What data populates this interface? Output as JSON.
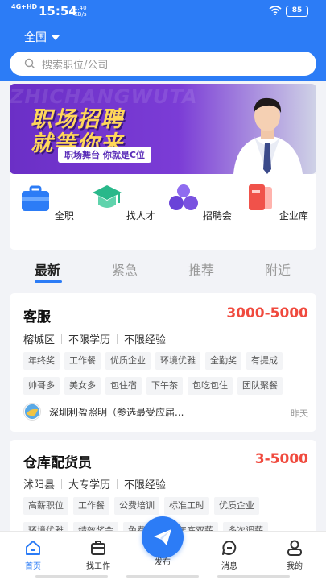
{
  "status": {
    "network": "4G+HD",
    "time": "15:54",
    "speed_value": "1.40",
    "speed_unit": "KB/s",
    "battery": "85"
  },
  "region": "全国",
  "search": {
    "placeholder": "搜索职位/公司"
  },
  "banner": {
    "watermark": "ZHICHANGWUTA",
    "line1": "职场招聘",
    "line2": "就等你来",
    "subtitle": "职场舞台 你就是C位"
  },
  "quick_links": [
    {
      "label": "全职",
      "icon": "briefcase-icon",
      "color": "#2c7cf6"
    },
    {
      "label": "找人才",
      "icon": "graduation-cap-icon",
      "color": "#29b88a"
    },
    {
      "label": "招聘会",
      "icon": "cluster-icon",
      "color": "#7a52e0"
    },
    {
      "label": "企业库",
      "icon": "documents-icon",
      "color": "#f0524a"
    }
  ],
  "tabs": [
    "最新",
    "紧急",
    "推荐",
    "附近"
  ],
  "active_tab": "最新",
  "jobs": [
    {
      "title": "客服",
      "salary": "3000-5000",
      "meta": [
        "榕城区",
        "不限学历",
        "不限经验"
      ],
      "tags_row1": [
        "年终奖",
        "工作餐",
        "优质企业",
        "环境优雅",
        "全勤奖",
        "有提成"
      ],
      "tags_row2": [
        "帅哥多",
        "美女多",
        "包住宿",
        "下午茶",
        "包吃包住",
        "团队聚餐"
      ],
      "company": "深圳利盈照明（参选最受应届...",
      "date": "昨天"
    },
    {
      "title": "仓库配货员",
      "salary": "3-5000",
      "meta": [
        "沭阳县",
        "大专学历",
        "不限经验"
      ],
      "tags_row1": [
        "高薪职位",
        "工作餐",
        "公费培训",
        "标准工时",
        "优质企业"
      ],
      "tags_row2": [
        "环境优雅",
        "绩效奖金",
        "免费班车",
        "年底双薪",
        "多次调薪"
      ]
    }
  ],
  "bottom_nav": {
    "home": "首页",
    "jobs": "找工作",
    "publish": "发布",
    "messages": "消息",
    "mine": "我的"
  },
  "colors": {
    "primary": "#2c7cf6",
    "salary": "#f04a3e"
  }
}
